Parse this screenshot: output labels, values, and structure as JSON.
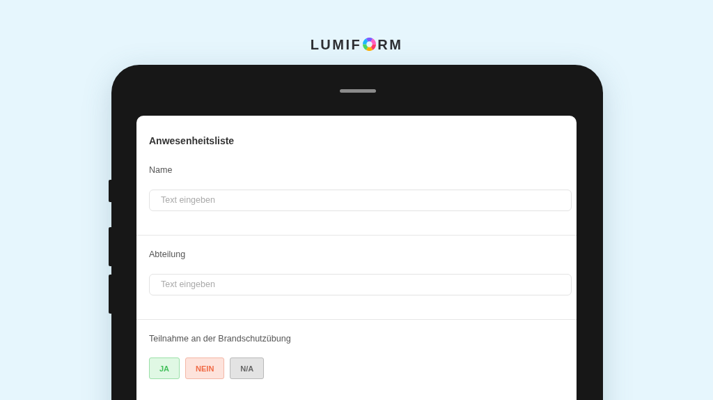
{
  "logo": {
    "before": "LUMIF",
    "after": "RM"
  },
  "form": {
    "title": "Anwesenheitsliste",
    "fields": [
      {
        "label": "Name",
        "placeholder": "Text eingeben"
      },
      {
        "label": "Abteilung",
        "placeholder": "Text eingeben"
      }
    ],
    "question": {
      "label": "Teilnahme an der Brandschutzübung",
      "options": [
        {
          "label": "JA",
          "kind": "yes"
        },
        {
          "label": "NEIN",
          "kind": "no"
        },
        {
          "label": "N/A",
          "kind": "na"
        }
      ]
    }
  }
}
